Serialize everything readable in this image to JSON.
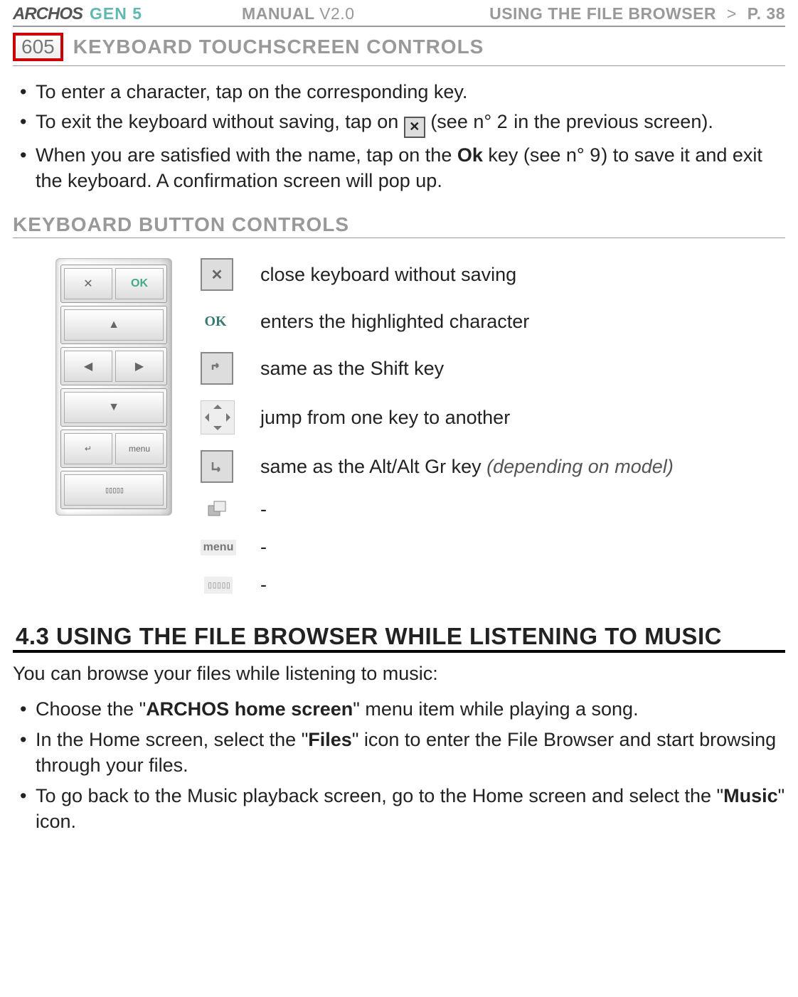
{
  "header": {
    "logo": "ARCHOS",
    "gen": "GEN 5",
    "manual": "MANUAL",
    "version": "V2.0",
    "breadcrumb_section": "USING THE FILE BROWSER",
    "breadcrumb_sep": ">",
    "page_label": "P. 38"
  },
  "model_badge": "605",
  "section1_title": "KEYBOARD TOUCHSCREEN CONTROLS",
  "touch_bullets": {
    "b1": "To enter a character, tap on the corresponding key.",
    "b2_a": "To exit the keyboard without saving, tap on ",
    "b2_b": " (see n° ",
    "b2_n": "2",
    "b2_c": " in the previous screen).",
    "b3_a": "When you are satisfied with the name, tap on the ",
    "b3_ok": "Ok",
    "b3_b": " key (see n° ",
    "b3_n": "9",
    "b3_c": ") to save it and exit the keyboard. A confirmation screen will pop up."
  },
  "section2_title": "KEYBOARD BUTTON CONTROLS",
  "button_controls": {
    "r1": "close keyboard without saving",
    "r2": "enters the highlighted character",
    "r3": "same as the Shift key",
    "r4": "jump from one key to another",
    "r5_a": "same as the Alt/Alt Gr key ",
    "r5_b": "(depending on model)",
    "r6": "-",
    "r7": "-",
    "r8": "-"
  },
  "icons": {
    "ok_label": "OK",
    "menu_label": "menu"
  },
  "section43_title": "4.3 USING THE FILE BROWSER WHILE LISTENING TO MUSIC",
  "body43": "You can browse your files while listening to music:",
  "bullets43": {
    "b1_a": "Choose the \"",
    "b1_bold": "ARCHOS home screen",
    "b1_b": "\" menu item while playing a song.",
    "b2_a": "In the Home screen, select the \"",
    "b2_bold": "Files",
    "b2_b": "\" icon to enter the File Browser and start browsing through your files.",
    "b3_a": "To go back to the Music playback screen, go to the Home screen and select the \"",
    "b3_bold": "Music",
    "b3_b": "\" icon."
  }
}
